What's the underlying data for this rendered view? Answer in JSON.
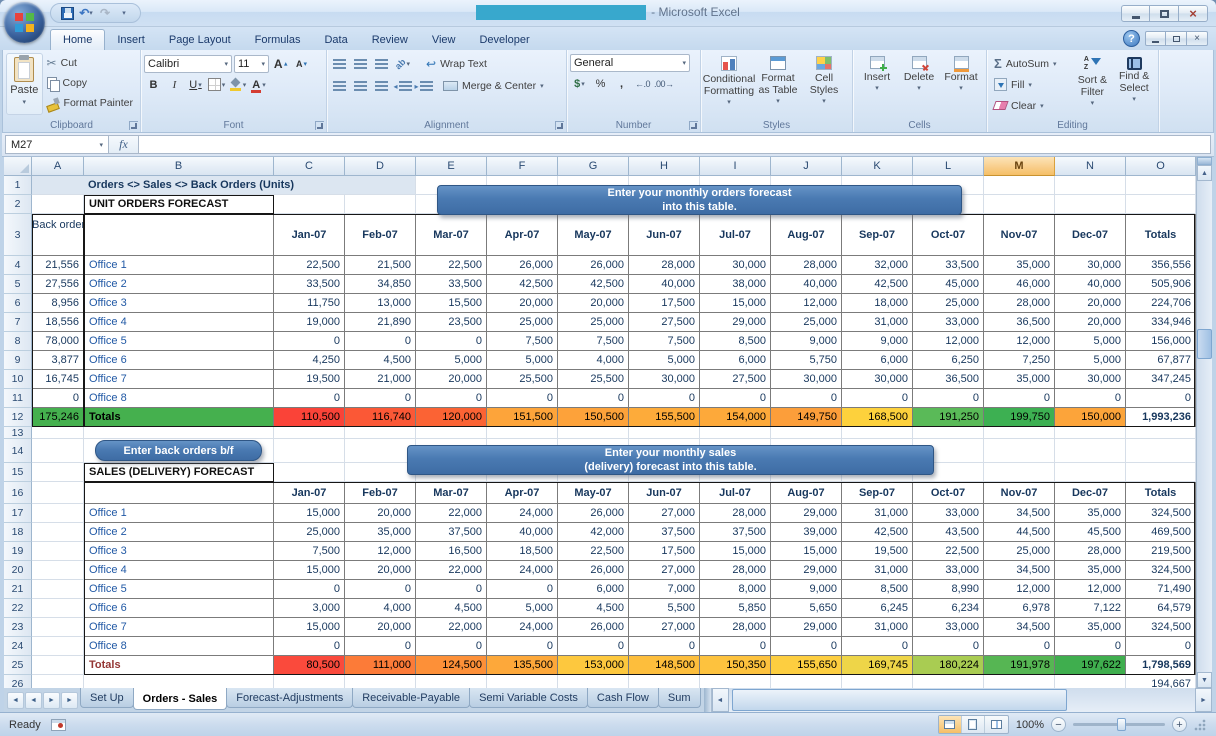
{
  "window": {
    "title": "- Microsoft Excel"
  },
  "icons": {
    "dropdown": "▾",
    "undo": "↶",
    "redo": "↷",
    "cut": "✂",
    "bold": "B",
    "italic": "I",
    "underline": "U",
    "font_color_letter": "A",
    "grow_font_letter": "A",
    "shrink_font_letter": "A",
    "orientation": "ab",
    "wrap_return": "↩",
    "indent_left": "◂",
    "indent_right": "▸",
    "currency": "$",
    "percent": "%",
    "comma": ",",
    "inc_decimal": "←.0",
    "dec_decimal": ".00→",
    "autosum": "Σ",
    "sort_a": "A",
    "sort_z": "Z",
    "help": "?",
    "close": "×",
    "up": "▲",
    "down": "▼",
    "left": "◄",
    "right": "►",
    "zoom_out": "−",
    "zoom_in": "+"
  },
  "ribbon_tabs": [
    {
      "label": "Home",
      "active": true
    },
    {
      "label": "Insert"
    },
    {
      "label": "Page Layout"
    },
    {
      "label": "Formulas"
    },
    {
      "label": "Data"
    },
    {
      "label": "Review"
    },
    {
      "label": "View"
    },
    {
      "label": "Developer"
    }
  ],
  "ribbon": {
    "clipboard": {
      "label": "Clipboard",
      "paste": "Paste",
      "cut": "Cut",
      "copy": "Copy",
      "format_painter": "Format Painter"
    },
    "font": {
      "label": "Font",
      "name": "Calibri",
      "size": "11"
    },
    "alignment": {
      "label": "Alignment",
      "wrap_text": "Wrap Text",
      "merge_center": "Merge & Center"
    },
    "number": {
      "label": "Number",
      "format": "General"
    },
    "styles": {
      "label": "Styles",
      "items": [
        "Conditional Formatting",
        "Format as Table",
        "Cell Styles"
      ]
    },
    "cells": {
      "label": "Cells",
      "items": [
        "Insert",
        "Delete",
        "Format"
      ]
    },
    "editing": {
      "label": "Editing",
      "autosum": "AutoSum",
      "fill": "Fill",
      "clear": "Clear",
      "sort_filter": "Sort & Filter",
      "find_select": "Find & Select"
    }
  },
  "formula_bar": {
    "name_box": "M27",
    "fx": "fx",
    "value": ""
  },
  "grid": {
    "columns": [
      "A",
      "B",
      "C",
      "D",
      "E",
      "F",
      "G",
      "H",
      "I",
      "J",
      "K",
      "L",
      "M",
      "N",
      "O"
    ],
    "selected_column": "M",
    "rows_visible": 26
  },
  "sheet": {
    "banner": "Orders <> Sales <> Back Orders (Units)",
    "months": [
      "Jan-07",
      "Feb-07",
      "Mar-07",
      "Apr-07",
      "May-07",
      "Jun-07",
      "Jul-07",
      "Aug-07",
      "Sep-07",
      "Oct-07",
      "Nov-07",
      "Dec-07"
    ],
    "totals_header": "Totals",
    "callout_orders": [
      "Enter your monthly orders forecast",
      "into this table."
    ],
    "callout_sales": [
      "Enter your monthly sales",
      "(delivery) forecast into this table."
    ],
    "back_orders_button": "Enter back orders b/f",
    "unit_orders": {
      "title": "UNIT ORDERS FORECAST",
      "back_orders_header": "Back orders",
      "offices": [
        {
          "label": "Office 1",
          "back": "21,556",
          "values": [
            "22,500",
            "21,500",
            "22,500",
            "26,000",
            "26,000",
            "28,000",
            "30,000",
            "28,000",
            "32,000",
            "33,500",
            "35,000",
            "30,000"
          ],
          "total": "356,556"
        },
        {
          "label": "Office 2",
          "back": "27,556",
          "values": [
            "33,500",
            "34,850",
            "33,500",
            "42,500",
            "42,500",
            "40,000",
            "38,000",
            "40,000",
            "42,500",
            "45,000",
            "46,000",
            "40,000"
          ],
          "total": "505,906"
        },
        {
          "label": "Office 3",
          "back": "8,956",
          "values": [
            "11,750",
            "13,000",
            "15,500",
            "20,000",
            "20,000",
            "17,500",
            "15,000",
            "12,000",
            "18,000",
            "25,000",
            "28,000",
            "20,000"
          ],
          "total": "224,706"
        },
        {
          "label": "Office 4",
          "back": "18,556",
          "values": [
            "19,000",
            "21,890",
            "23,500",
            "25,000",
            "25,000",
            "27,500",
            "29,000",
            "25,000",
            "31,000",
            "33,000",
            "36,500",
            "20,000"
          ],
          "total": "334,946"
        },
        {
          "label": "Office 5",
          "back": "78,000",
          "values": [
            "0",
            "0",
            "0",
            "7,500",
            "7,500",
            "7,500",
            "8,500",
            "9,000",
            "9,000",
            "12,000",
            "12,000",
            "5,000"
          ],
          "total": "156,000"
        },
        {
          "label": "Office 6",
          "back": "3,877",
          "values": [
            "4,250",
            "4,500",
            "5,000",
            "5,000",
            "4,000",
            "5,000",
            "6,000",
            "5,750",
            "6,000",
            "6,250",
            "7,250",
            "5,000"
          ],
          "total": "67,877"
        },
        {
          "label": "Office 7",
          "back": "16,745",
          "values": [
            "19,500",
            "21,000",
            "20,000",
            "25,500",
            "25,500",
            "30,000",
            "27,500",
            "30,000",
            "30,000",
            "36,500",
            "35,000",
            "30,000"
          ],
          "total": "347,245"
        },
        {
          "label": "Office 8",
          "back": "0",
          "values": [
            "0",
            "0",
            "0",
            "0",
            "0",
            "0",
            "0",
            "0",
            "0",
            "0",
            "0",
            "0"
          ],
          "total": "0"
        }
      ],
      "totals": {
        "label": "Totals",
        "back_total": "175,246",
        "back_color": "#45b04e",
        "values": [
          "110,500",
          "116,740",
          "120,000",
          "151,500",
          "150,500",
          "155,500",
          "154,000",
          "149,750",
          "168,500",
          "191,250",
          "199,750",
          "150,000"
        ],
        "colors": [
          "#fa4338",
          "#fb5836",
          "#fb6334",
          "#fda43a",
          "#fda23a",
          "#fdab3a",
          "#fda93a",
          "#fc9e3a",
          "#fdd13c",
          "#5aba58",
          "#3db052",
          "#fca43a"
        ],
        "total": "1,993,236"
      }
    },
    "sales_forecast": {
      "title": "SALES (DELIVERY) FORECAST",
      "offices": [
        {
          "label": "Office 1",
          "values": [
            "15,000",
            "20,000",
            "22,000",
            "24,000",
            "26,000",
            "27,000",
            "28,000",
            "29,000",
            "31,000",
            "33,000",
            "34,500",
            "35,000"
          ],
          "total": "324,500"
        },
        {
          "label": "Office 2",
          "values": [
            "25,000",
            "35,000",
            "37,500",
            "40,000",
            "42,000",
            "37,500",
            "37,500",
            "39,000",
            "42,500",
            "43,500",
            "44,500",
            "45,500"
          ],
          "total": "469,500"
        },
        {
          "label": "Office 3",
          "values": [
            "7,500",
            "12,000",
            "16,500",
            "18,500",
            "22,500",
            "17,500",
            "15,000",
            "15,000",
            "19,500",
            "22,500",
            "25,000",
            "28,000"
          ],
          "total": "219,500"
        },
        {
          "label": "Office 4",
          "values": [
            "15,000",
            "20,000",
            "22,000",
            "24,000",
            "26,000",
            "27,000",
            "28,000",
            "29,000",
            "31,000",
            "33,000",
            "34,500",
            "35,000"
          ],
          "total": "324,500"
        },
        {
          "label": "Office 5",
          "values": [
            "0",
            "0",
            "0",
            "0",
            "6,000",
            "7,000",
            "8,000",
            "9,000",
            "8,500",
            "8,990",
            "12,000",
            "12,000"
          ],
          "total": "71,490"
        },
        {
          "label": "Office 6",
          "values": [
            "3,000",
            "4,000",
            "4,500",
            "5,000",
            "4,500",
            "5,500",
            "5,850",
            "5,650",
            "6,245",
            "6,234",
            "6,978",
            "7,122"
          ],
          "total": "64,579"
        },
        {
          "label": "Office 7",
          "values": [
            "15,000",
            "20,000",
            "22,000",
            "24,000",
            "26,000",
            "27,000",
            "28,000",
            "29,000",
            "31,000",
            "33,000",
            "34,500",
            "35,000"
          ],
          "total": "324,500"
        },
        {
          "label": "Office 8",
          "values": [
            "0",
            "0",
            "0",
            "0",
            "0",
            "0",
            "0",
            "0",
            "0",
            "0",
            "0",
            "0"
          ],
          "total": "0"
        }
      ],
      "totals": {
        "label": "Totals",
        "values": [
          "80,500",
          "111,000",
          "124,500",
          "135,500",
          "153,000",
          "148,500",
          "150,350",
          "155,650",
          "169,745",
          "180,224",
          "191,978",
          "197,622"
        ],
        "colors": [
          "#fa4a3c",
          "#fc7b38",
          "#fd9038",
          "#fda83a",
          "#fdc83e",
          "#fdbe3c",
          "#fdc23e",
          "#fdce40",
          "#eed548",
          "#a9cc52",
          "#56b653",
          "#3fae4e"
        ],
        "total": "1,798,569"
      }
    },
    "row26_total": "194,667"
  },
  "sheet_tabs": {
    "tabs": [
      "Set Up",
      "Orders - Sales",
      "Forecast-Adjustments",
      "Receivable-Payable",
      "Semi Variable Costs",
      "Cash Flow",
      "Sum"
    ],
    "active": "Orders - Sales"
  },
  "status_bar": {
    "mode": "Ready",
    "zoom": "100%"
  }
}
